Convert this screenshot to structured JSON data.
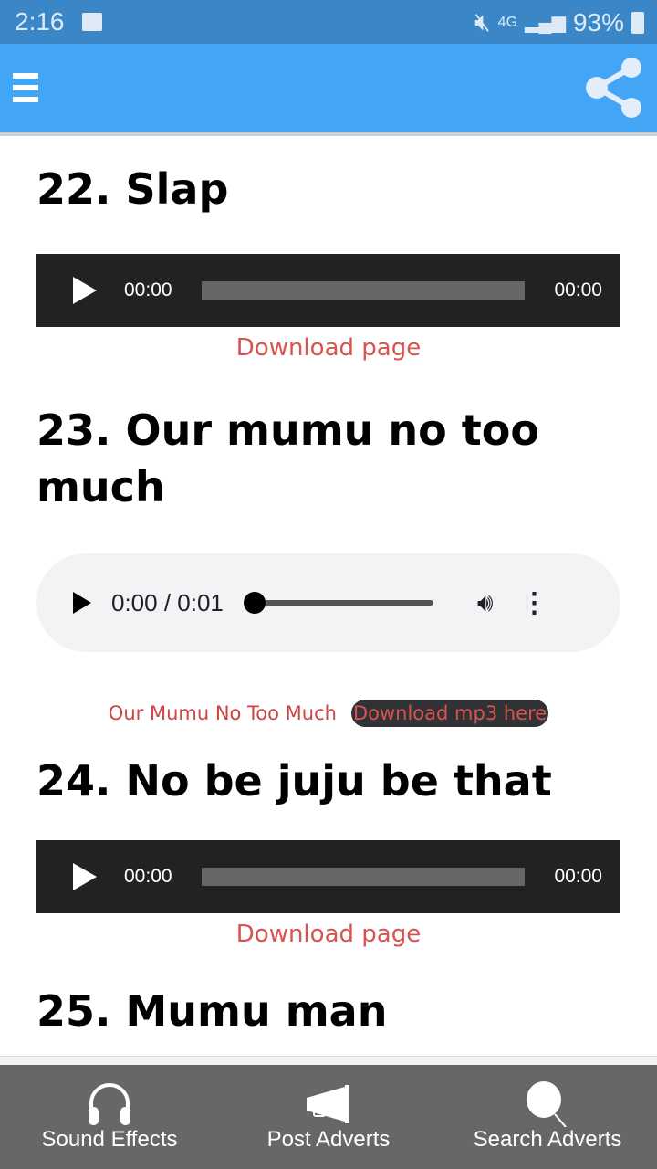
{
  "status": {
    "time": "2:16",
    "network": "4G",
    "battery": "93%"
  },
  "appbar": {
    "menu_icon": "hamburger-icon",
    "share_icon": "share-icon"
  },
  "sections": [
    {
      "title": "22. Slap",
      "player": {
        "current": "00:00",
        "duration": "00:00"
      },
      "download": "Download page"
    },
    {
      "title": "23. Our mumu no too much",
      "player": {
        "time": "0:00 / 0:01",
        "progress": 0
      },
      "caption": "Our Mumu No Too Much",
      "download": "Download mp3 here"
    },
    {
      "title": "24. No be juju be that",
      "player": {
        "current": "00:00",
        "duration": "00:00"
      },
      "download": "Download page"
    },
    {
      "title": "25. Mumu man"
    }
  ],
  "bottom_nav": [
    {
      "label": "Sound Effects",
      "icon": "headphones-icon"
    },
    {
      "label": "Post Adverts",
      "icon": "megaphone-icon"
    },
    {
      "label": "Search Adverts",
      "icon": "search-icon"
    }
  ]
}
